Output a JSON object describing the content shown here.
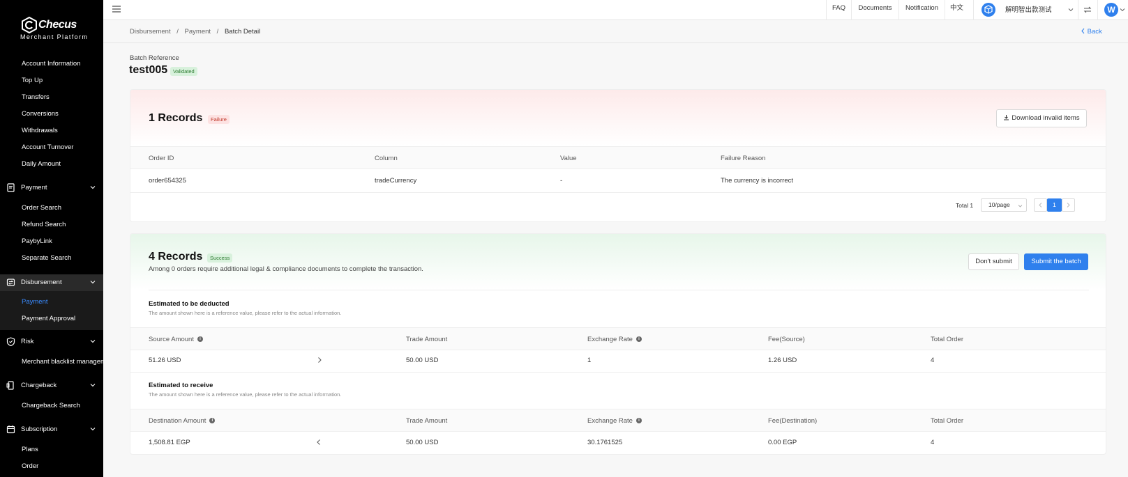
{
  "brand": {
    "name": "Checus",
    "subtitle": "Merchant  Platform"
  },
  "sidebar": {
    "items_top": [
      {
        "label": "Account Information"
      },
      {
        "label": "Top Up"
      },
      {
        "label": "Transfers"
      },
      {
        "label": "Conversions"
      },
      {
        "label": "Withdrawals"
      },
      {
        "label": "Account Turnover"
      },
      {
        "label": "Daily Amount"
      }
    ],
    "groups": [
      {
        "label": "Payment",
        "icon": "receipt-icon",
        "items": [
          "Order Search",
          "Refund Search",
          "PaybyLink",
          "Separate Search"
        ]
      },
      {
        "label": "Disbursement",
        "icon": "transfer-icon",
        "items": [
          "Payment",
          "Payment Approval"
        ]
      },
      {
        "label": "Risk",
        "icon": "shield-icon",
        "items": [
          "Merchant blacklist management"
        ]
      },
      {
        "label": "Chargeback",
        "icon": "phone-icon",
        "items": [
          "Chargeback Search"
        ]
      },
      {
        "label": "Subscription",
        "icon": "calendar-icon",
        "items": [
          "Plans",
          "Order"
        ]
      }
    ],
    "active_item": "Payment"
  },
  "topbar": {
    "links": [
      "FAQ",
      "Documents",
      "Notification",
      "中文"
    ],
    "user": "解明智出款测试",
    "avatar_letter": "W"
  },
  "breadcrumb": {
    "items": [
      "Disbursement",
      "Payment",
      "Batch Detail"
    ],
    "sep": "/"
  },
  "back_label": "Back",
  "batch": {
    "label": "Batch Reference",
    "name": "test005",
    "status": "Validated"
  },
  "failure": {
    "count_label": "1 Records",
    "status": "Failure",
    "download_label": "Download invalid items",
    "columns": [
      "Order ID",
      "Column",
      "Value",
      "Failure Reason"
    ],
    "rows": [
      [
        "order654325",
        "tradeCurrency",
        "-",
        "The currency is incorrect"
      ]
    ],
    "total": "Total 1",
    "page_size": "10/page",
    "page": "1"
  },
  "success": {
    "count_label": "4 Records",
    "status": "Success",
    "note": "Among 0 orders require additional legal & compliance documents to complete the transaction.",
    "dont_submit": "Don't submit",
    "submit": "Submit the batch",
    "deducted": {
      "title": "Estimated to be deducted",
      "note": "The amount shown here is a reference value, please refer to the actual information.",
      "columns": [
        "Source Amount",
        "Trade Amount",
        "Exchange Rate",
        "Fee(Source)",
        "Total Order"
      ],
      "row": [
        "51.26 USD",
        "50.00 USD",
        "1",
        "1.26 USD",
        "4"
      ]
    },
    "receive": {
      "title": "Estimated to receive",
      "note": "The amount shown here is a reference value, please refer to the actual information.",
      "columns": [
        "Destination Amount",
        "Trade Amount",
        "Exchange Rate",
        "Fee(Destination)",
        "Total Order"
      ],
      "row": [
        "1,508.81 EGP",
        "50.00 USD",
        "30.1761525",
        "0.00 EGP",
        "4"
      ]
    }
  },
  "colors": {
    "accent": "#2f80ed",
    "failure_bg": "#fde2e2",
    "success_bg": "#d8f1dc",
    "validated_bg": "#d8f1dc"
  }
}
